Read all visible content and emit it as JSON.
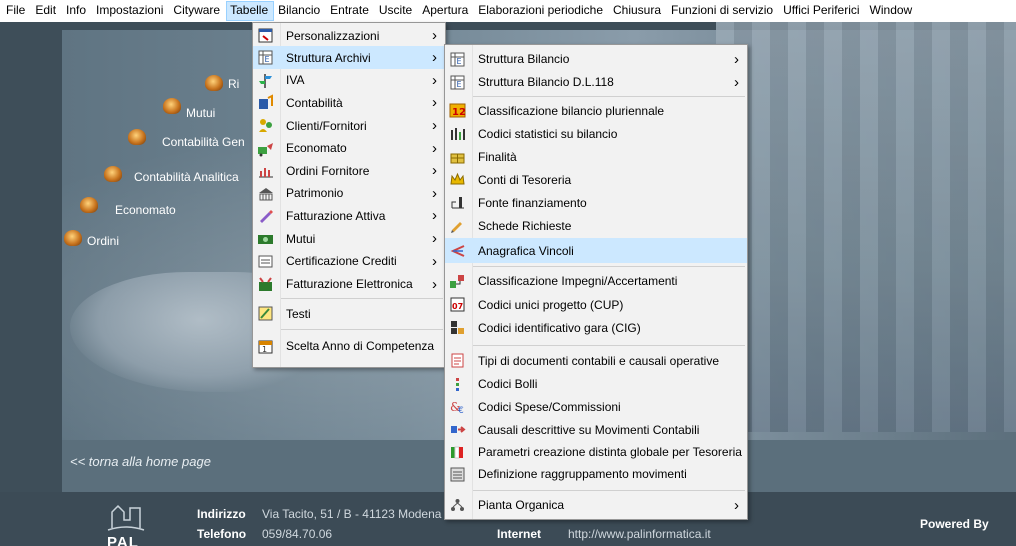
{
  "menubar": [
    "File",
    "Edit",
    "Info",
    "Impostazioni",
    "Cityware",
    "Tabelle",
    "Bilancio",
    "Entrate",
    "Uscite",
    "Apertura",
    "Elaborazioni periodiche",
    "Chiusura",
    "Funzioni di servizio",
    "Uffici Periferici",
    "Window"
  ],
  "background": {
    "orbs": [
      "Ri",
      "Mutui",
      "Contabilità Gen",
      "Contabilità Analitica",
      "Economato",
      "Ordini"
    ],
    "home_link": "<< torna alla home page",
    "footer": {
      "indirizzo_label": "Indirizzo",
      "indirizzo_value": "Via Tacito, 51 / B - 41123 Modena",
      "telefono_label": "Telefono",
      "telefono_value": "059/84.70.06",
      "internet_label": "Internet",
      "internet_value": "http://www.palinformatica.it",
      "powered_by": "Powered By",
      "logo_text": "PAL"
    }
  },
  "menu_tabelle": [
    {
      "label": "Personalizzazioni",
      "submenu": true,
      "icon": "window-icon"
    },
    {
      "label": "Struttura Archivi",
      "submenu": true,
      "icon": "archive-table-icon",
      "highlighted": true
    },
    {
      "label": "IVA",
      "submenu": true,
      "icon": "signpost-icon"
    },
    {
      "label": "Contabilità",
      "submenu": true,
      "icon": "ledger-icon"
    },
    {
      "label": "Clienti/Fornitori",
      "submenu": true,
      "icon": "people-icon"
    },
    {
      "label": "Economato",
      "submenu": true,
      "icon": "cart-icon"
    },
    {
      "label": "Ordini Fornitore",
      "submenu": true,
      "icon": "bar-chart-icon"
    },
    {
      "label": "Patrimonio",
      "submenu": true,
      "icon": "building-icon"
    },
    {
      "label": "Fatturazione Attiva",
      "submenu": true,
      "icon": "pen-icon"
    },
    {
      "label": "Mutui",
      "submenu": true,
      "icon": "money-icon"
    },
    {
      "label": "Certificazione Crediti",
      "submenu": true,
      "icon": "certificate-icon"
    },
    {
      "label": "Fatturazione Elettronica",
      "submenu": true,
      "icon": "e-invoice-icon"
    },
    {
      "label": "Testi",
      "submenu": false,
      "icon": "text-edit-icon"
    },
    {
      "label": "Scelta Anno di Competenza",
      "submenu": false,
      "icon": "calendar-icon"
    }
  ],
  "menu_struttura": [
    {
      "label": "Struttura Bilancio",
      "submenu": true,
      "icon": "archive-table-icon"
    },
    {
      "label": "Struttura Bilancio D.L.118",
      "submenu": true,
      "icon": "archive-table-icon"
    },
    {
      "label": "Classificazione bilancio pluriennale",
      "submenu": false,
      "icon": "numbered-icon"
    },
    {
      "label": "Codici statistici su bilancio",
      "submenu": false,
      "icon": "stats-icon"
    },
    {
      "label": "Finalità",
      "submenu": false,
      "icon": "gift-icon"
    },
    {
      "label": "Conti di Tesoreria",
      "submenu": false,
      "icon": "crown-icon"
    },
    {
      "label": "Fonte finanziamento",
      "submenu": false,
      "icon": "source-icon"
    },
    {
      "label": "Schede Richieste",
      "submenu": false,
      "icon": "pencil-icon"
    },
    {
      "label": "Anagrafica Vincoli",
      "submenu": false,
      "icon": "link-arrow-icon",
      "highlighted": true
    },
    {
      "label": "Classificazione Impegni/Accertamenti",
      "submenu": false,
      "icon": "classify-icon"
    },
    {
      "label": "Codici unici progetto (CUP)",
      "submenu": false,
      "icon": "cup-icon"
    },
    {
      "label": "Codici identificativo gara (CIG)",
      "submenu": false,
      "icon": "cig-icon"
    },
    {
      "label": "Tipi di documenti contabili e causali operative",
      "submenu": false,
      "icon": "document-icon"
    },
    {
      "label": "Codici Bolli",
      "submenu": false,
      "icon": "stamp-icon"
    },
    {
      "label": "Codici Spese/Commissioni",
      "submenu": false,
      "icon": "euro-icon"
    },
    {
      "label": "Causali descrittive su Movimenti Contabili",
      "submenu": false,
      "icon": "movement-icon"
    },
    {
      "label": "Parametri creazione distinta globale per Tesoreria",
      "submenu": false,
      "icon": "italy-flag-icon"
    },
    {
      "label": "Definizione raggruppamento movimenti",
      "submenu": false,
      "icon": "group-icon"
    },
    {
      "label": "Pianta Organica",
      "submenu": true,
      "icon": "org-chart-icon"
    }
  ]
}
